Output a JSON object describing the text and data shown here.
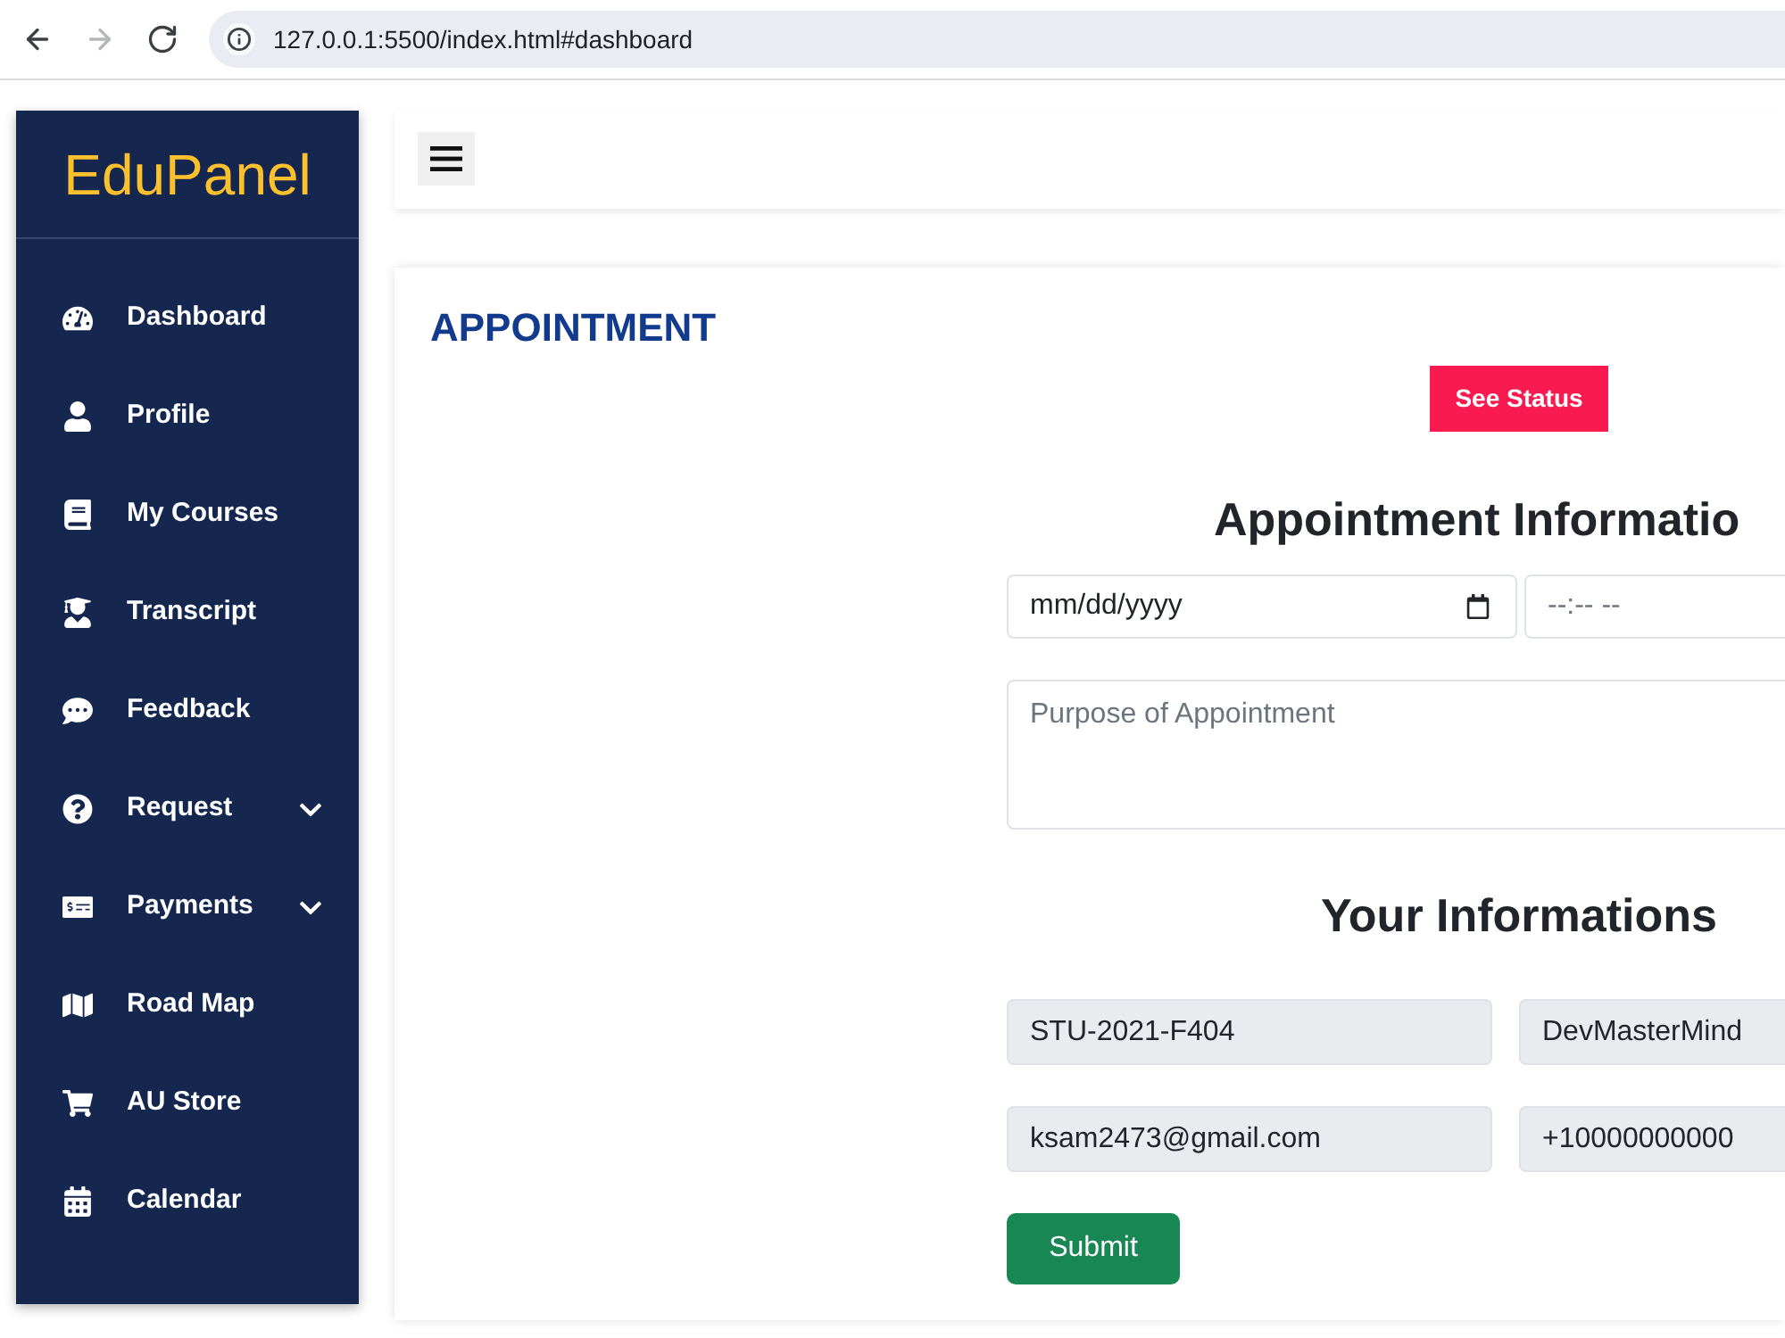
{
  "browser": {
    "nav_buttons": [
      {
        "kind": "back",
        "disabled": false
      },
      {
        "kind": "forward",
        "disabled": true
      },
      {
        "kind": "reload",
        "disabled": false
      }
    ],
    "url": "127.0.0.1:5500/index.html#dashboard"
  },
  "sidebar": {
    "logo": "EduPanel",
    "items": [
      {
        "label": "Dashboard",
        "expandable": false
      },
      {
        "label": "Profile",
        "expandable": false
      },
      {
        "label": "My Courses",
        "expandable": false
      },
      {
        "label": "Transcript",
        "expandable": false
      },
      {
        "label": "Feedback",
        "expandable": false
      },
      {
        "label": "Request",
        "expandable": true
      },
      {
        "label": "Payments",
        "expandable": true
      },
      {
        "label": "Road Map",
        "expandable": false
      },
      {
        "label": "AU Store",
        "expandable": false
      },
      {
        "label": "Calendar",
        "expandable": false
      }
    ]
  },
  "page": {
    "title": "APPOINTMENT",
    "status_button": "See Status"
  },
  "appointment_form": {
    "heading": "Appointment Informatio",
    "date": {
      "placeholder": "mm/dd/yyyy"
    },
    "time": {
      "placeholder": "--:-- --"
    },
    "purpose": {
      "placeholder": "Purpose of Appointment"
    }
  },
  "your_info": {
    "heading": "Your Informations",
    "fields": [
      {
        "value": "STU-2021-F404",
        "readonly": true
      },
      {
        "value": "DevMasterMind",
        "readonly": true
      },
      {
        "value": "ksam2473@gmail.com",
        "readonly": true
      },
      {
        "value": "+10000000000",
        "readonly": true
      }
    ]
  },
  "submit_button": "Submit"
}
